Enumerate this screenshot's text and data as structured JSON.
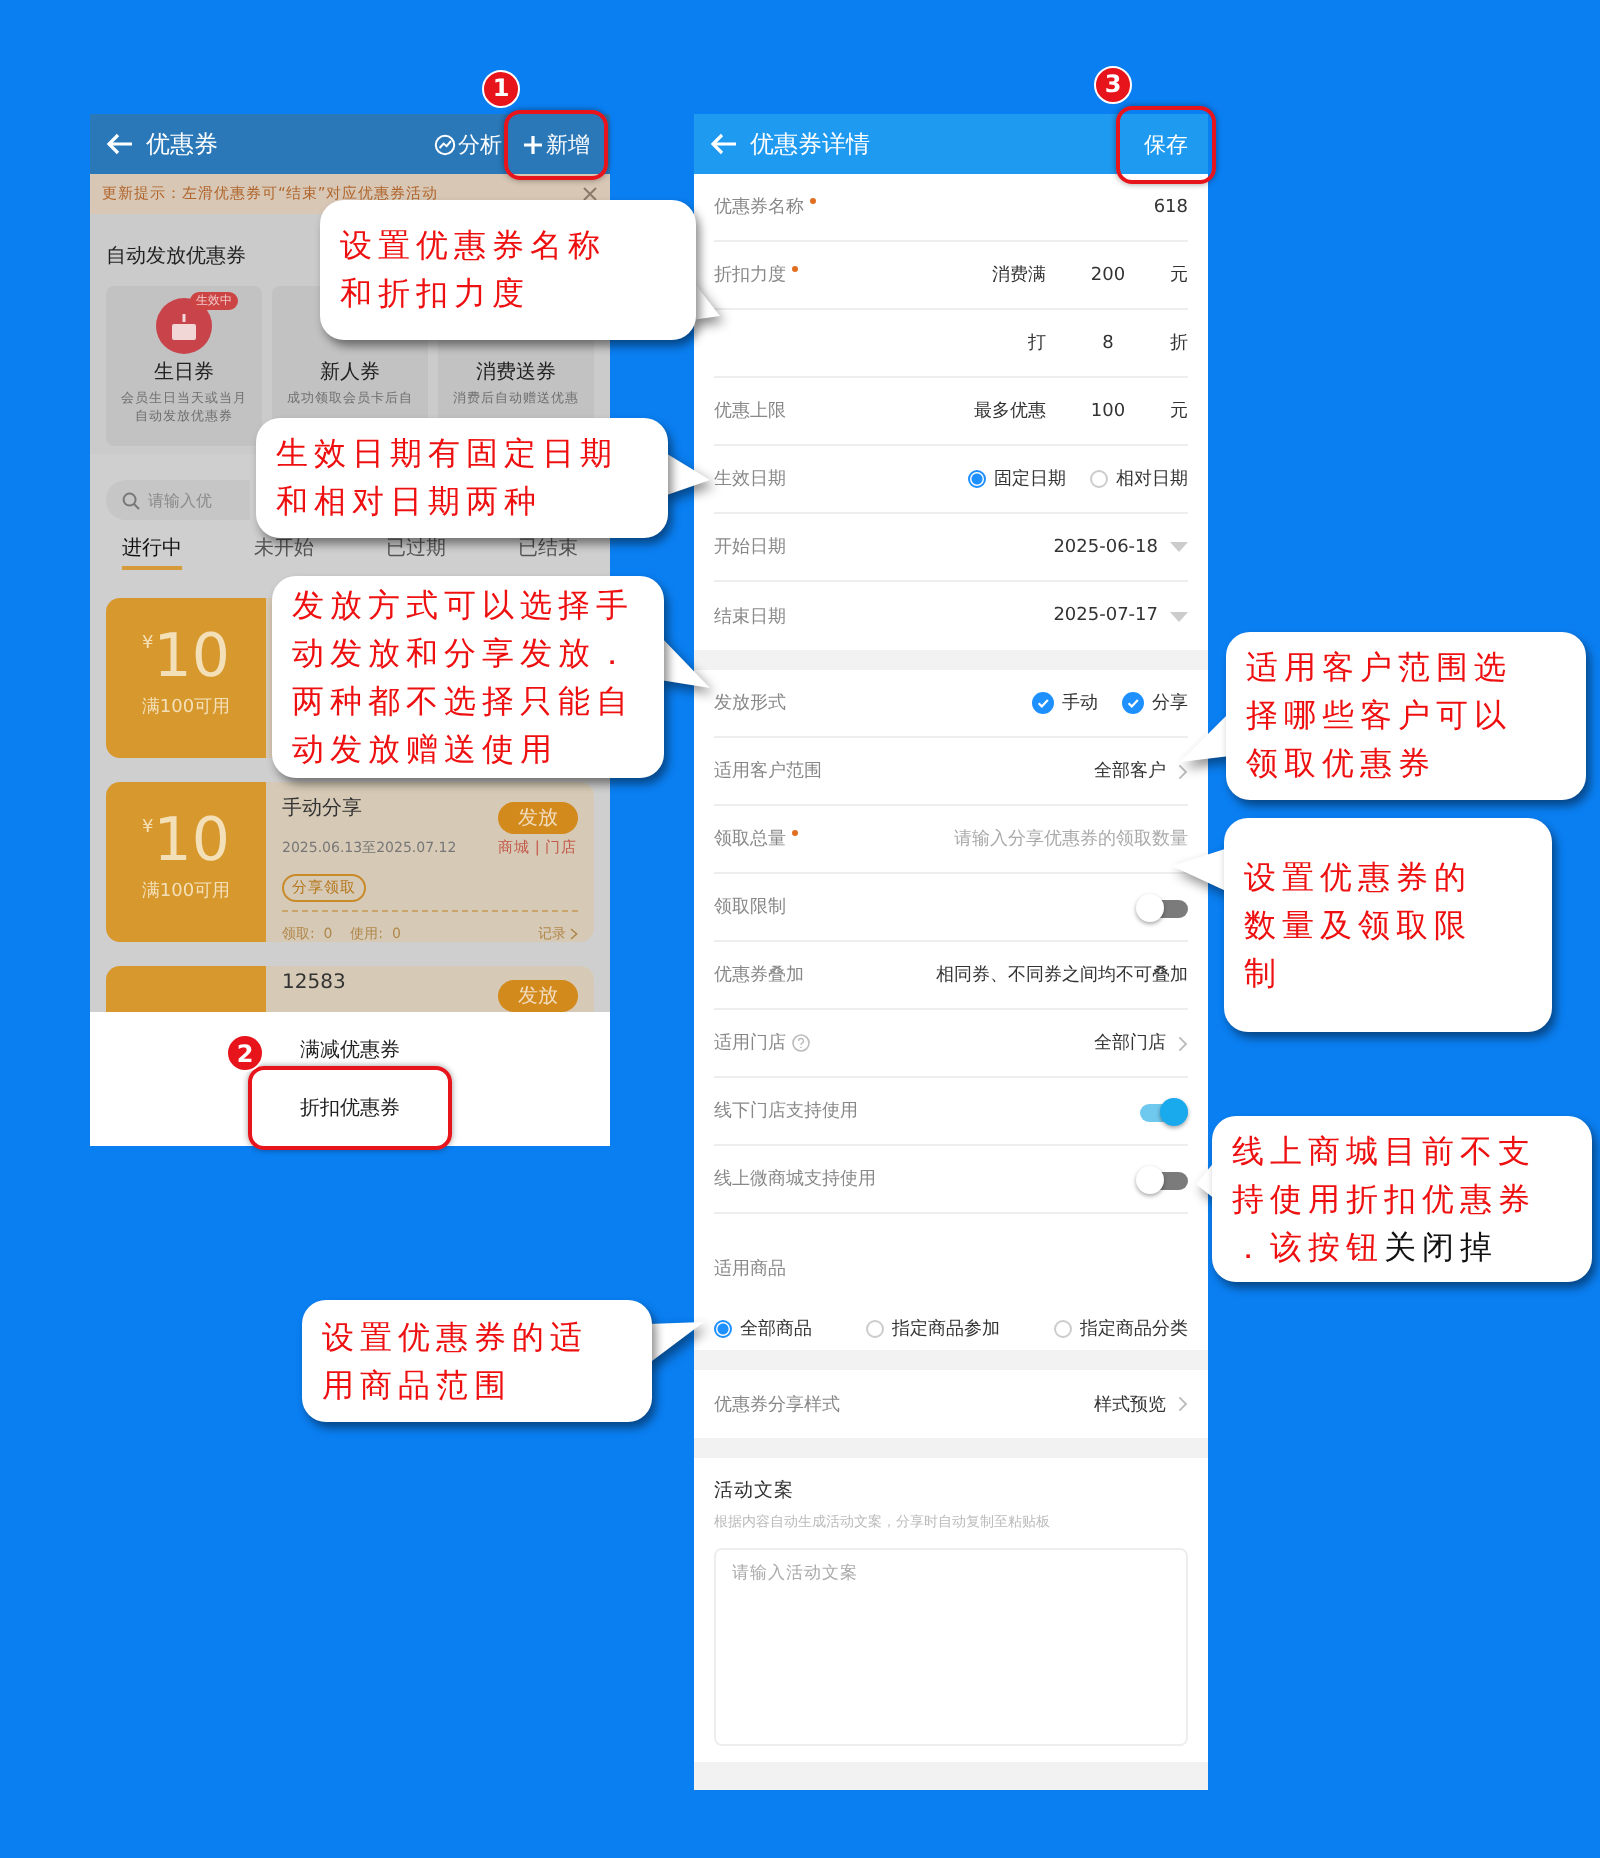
{
  "steps": [
    {
      "number": "1"
    },
    {
      "number": "2"
    },
    {
      "number": "3"
    }
  ],
  "list_screen": {
    "title": "优惠券",
    "actions": [
      {
        "kind": "chart",
        "label": "分析",
        "highlighted": false
      },
      {
        "kind": "add",
        "label": "新增",
        "highlighted": true
      }
    ],
    "notice": {
      "text": "更新提示：左滑优惠券可“结束”对应优惠券活动"
    },
    "auto_section": {
      "title": "自动发放优惠券",
      "cards": [
        {
          "name": "生日券",
          "badge": "生效中",
          "description": "会员生日当天或当月自动发放优惠券"
        },
        {
          "name": "新人券",
          "description": "成功领取会员卡后自"
        },
        {
          "name": "消费送券",
          "description": "消费后自动赠送优惠"
        }
      ]
    },
    "search": {
      "placeholder": "请输入优"
    },
    "tabs": [
      {
        "label": "进行中",
        "selected": true
      },
      {
        "label": "未开始",
        "selected": false
      },
      {
        "label": "已过期",
        "selected": false
      },
      {
        "label": "已结束",
        "selected": false
      }
    ],
    "coupons": [
      {
        "currency": "¥",
        "amount": "10",
        "condition": "满100可用"
      },
      {
        "currency": "¥",
        "amount": "10",
        "condition": "满100可用",
        "title": "手动分享",
        "period": "2025.06.13至2025.07.12",
        "channels": "商城 | 门店",
        "issue_button": "发放",
        "share_button": "分享领取",
        "stats": "领取:  0    使用:  0",
        "records_link": "记录"
      },
      {
        "title": "12583",
        "issue_button": "发放"
      }
    ],
    "sheet": {
      "options": [
        {
          "label": "满减优惠券",
          "highlighted": false
        },
        {
          "label": "折扣优惠券",
          "highlighted": true
        }
      ]
    }
  },
  "detail_screen": {
    "title": "优惠券详情",
    "save": {
      "label": "保存",
      "highlighted": true
    },
    "sections": [
      {
        "rows": [
          {
            "kind": "input",
            "label": "优惠券名称",
            "required": true,
            "value": "618"
          },
          {
            "kind": "amount",
            "label": "折扣力度",
            "required": true,
            "prefix": "消费满",
            "value": "200",
            "unit": "元"
          },
          {
            "kind": "amount",
            "prefix": "打",
            "value": "8",
            "unit": "折"
          },
          {
            "kind": "amount",
            "label": "优惠上限",
            "prefix": "最多优惠",
            "value": "100",
            "unit": "元"
          },
          {
            "kind": "radio",
            "label": "生效日期",
            "options": [
              {
                "label": "固定日期",
                "selected": true
              },
              {
                "label": "相对日期",
                "selected": false
              }
            ]
          },
          {
            "kind": "select",
            "label": "开始日期",
            "value": "2025-06-18"
          },
          {
            "kind": "select",
            "label": "结束日期",
            "value": "2025-07-17"
          }
        ]
      },
      {
        "rows": [
          {
            "kind": "checks",
            "label": "发放形式",
            "options": [
              {
                "label": "手动",
                "checked": true
              },
              {
                "label": "分享",
                "checked": true
              }
            ]
          },
          {
            "kind": "link",
            "label": "适用客户范围",
            "value": "全部客户"
          },
          {
            "kind": "input",
            "label": "领取总量",
            "required": true,
            "placeholder": "请输入分享优惠券的领取数量"
          },
          {
            "kind": "toggle",
            "label": "领取限制",
            "on": false
          },
          {
            "kind": "text",
            "label": "优惠券叠加",
            "value": "相同券、不同券之间均不可叠加"
          },
          {
            "kind": "link",
            "label": "适用门店",
            "help": true,
            "value": "全部门店"
          },
          {
            "kind": "toggle",
            "label": "线下门店支持使用",
            "on": true
          },
          {
            "kind": "toggle",
            "label": "线上微商城支持使用",
            "on": false
          },
          {
            "kind": "radioblock",
            "label": "适用商品",
            "options": [
              {
                "label": "全部商品",
                "selected": true
              },
              {
                "label": "指定商品参加",
                "selected": false
              },
              {
                "label": "指定商品分类",
                "selected": false
              }
            ]
          }
        ]
      },
      {
        "rows": [
          {
            "kind": "link",
            "label": "优惠券分享样式",
            "value": "样式预览"
          }
        ]
      },
      {
        "rows": [
          {
            "kind": "textarea",
            "label": "活动文案",
            "hint": "根据内容自动生成活动文案，分享时自动复制至粘贴板",
            "placeholder": "请输入活动文案"
          }
        ]
      }
    ]
  },
  "callouts": [
    {
      "lines": [
        "设置优惠券名称",
        "和折扣力度"
      ]
    },
    {
      "lines": [
        "生效日期有固定日期",
        "和相对日期两种"
      ]
    },
    {
      "lines": [
        "发放方式可以选择手",
        "动发放和分享发放．",
        "两种都不选择只能自",
        "动发放赠送使用"
      ]
    },
    {
      "lines": [
        "适用客户范围选",
        "择哪些客户可以",
        "领取优惠券"
      ]
    },
    {
      "lines": [
        "设置优惠券的",
        "数量及领取限",
        "制"
      ]
    },
    {
      "lines": [
        "线上商城目前不支",
        "持使用折扣优惠券",
        "．该按钮"
      ],
      "tail": "关闭掉"
    },
    {
      "lines": [
        "设置优惠券的适",
        "用商品范围"
      ]
    }
  ]
}
